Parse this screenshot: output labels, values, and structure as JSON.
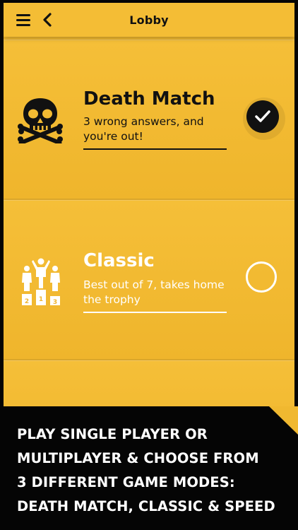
{
  "header": {
    "title": "Lobby"
  },
  "modes": [
    {
      "title": "Death Match",
      "description": "3 wrong answers, and you're out!",
      "icon": "skull-crossbones-icon",
      "selected": true
    },
    {
      "title": "Classic",
      "description": "Best out of 7, takes home the trophy",
      "icon": "podium-icon",
      "podium_labels": [
        "2",
        "1",
        "3"
      ],
      "selected": false
    }
  ],
  "caption": {
    "lines": [
      "PLAY SINGLE PLAYER OR",
      "MULTIPLAYER & CHOOSE FROM",
      "3 DIFFERENT GAME MODES:",
      "DEATH MATCH, CLASSIC & SPEED"
    ]
  },
  "colors": {
    "card": "#f0b830",
    "accent_dark": "#111111",
    "text_light": "#ffffff",
    "caption_bg": "#050505"
  }
}
